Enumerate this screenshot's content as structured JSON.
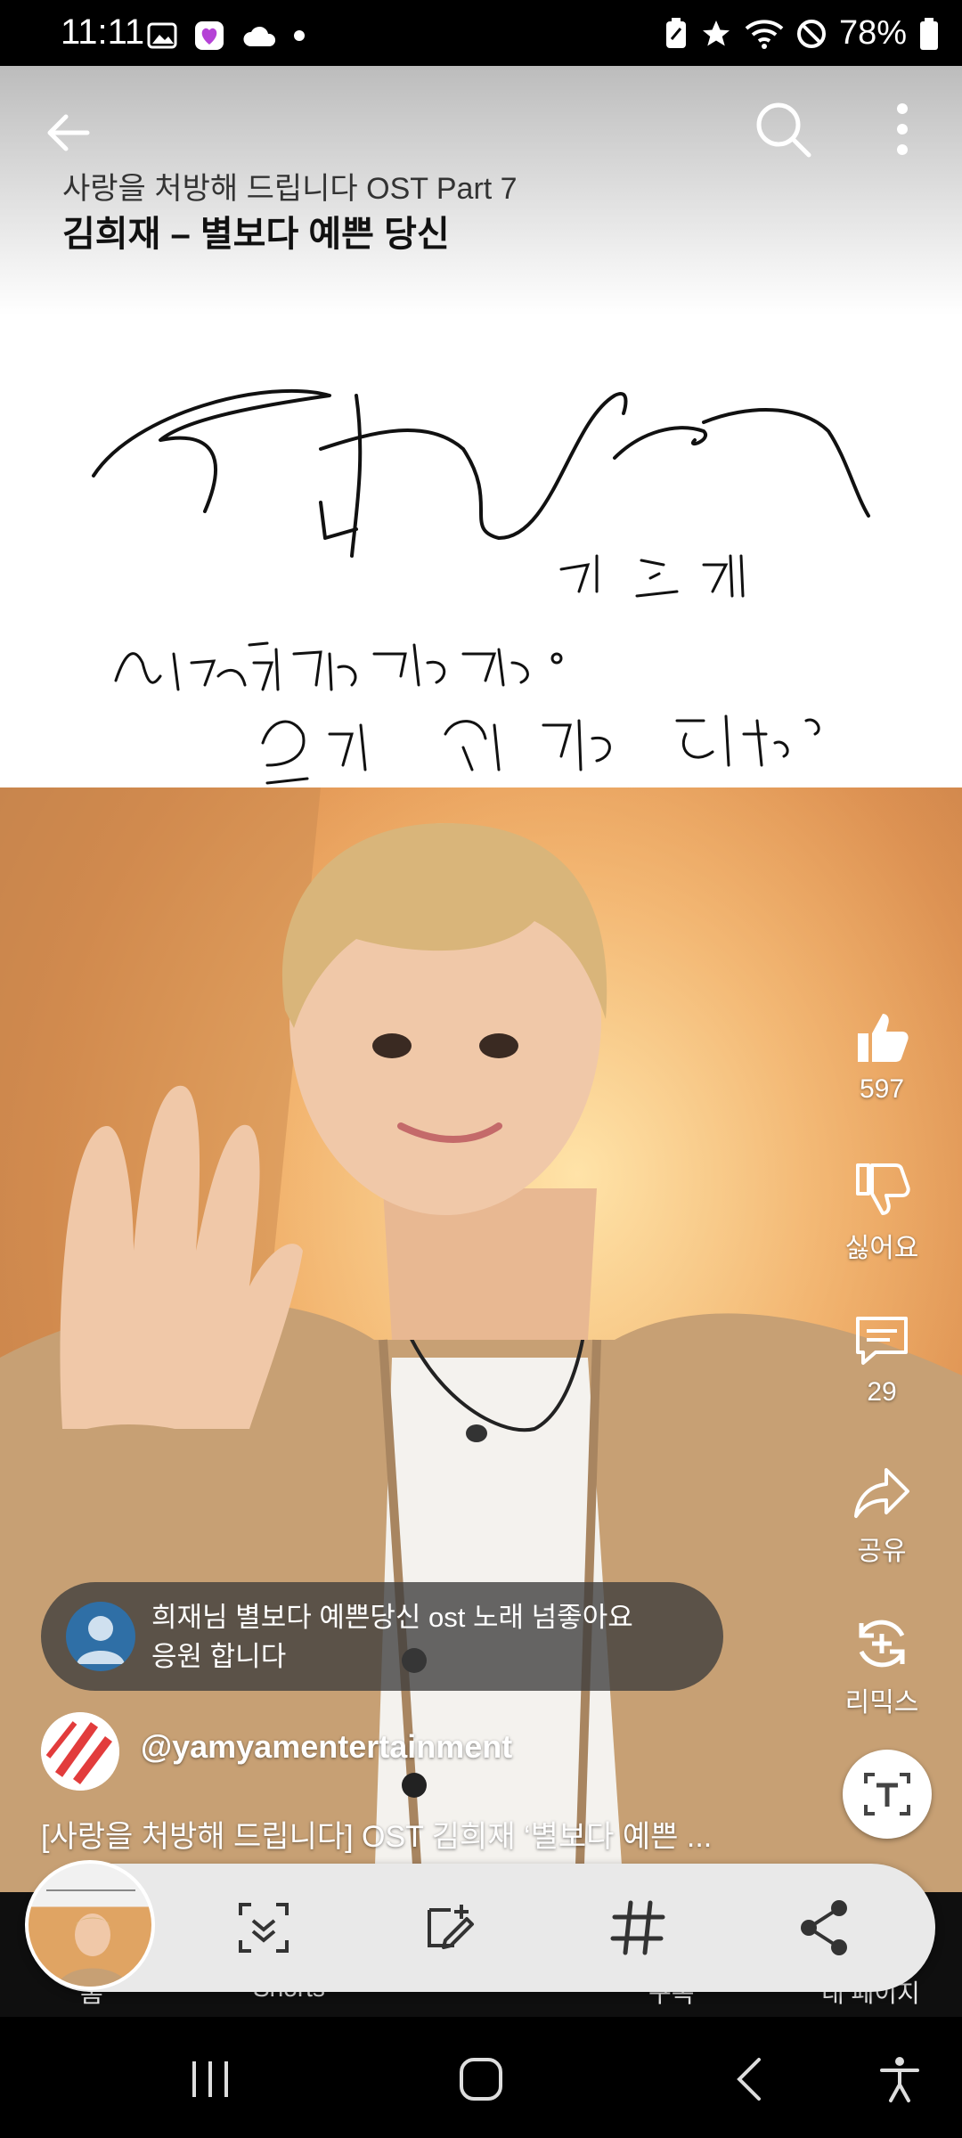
{
  "status_bar": {
    "time": "11:11",
    "battery": "78%"
  },
  "banner": {
    "ost_line": "사랑을 처방해 드립니다 OST Part 7",
    "song_line": "김희재 – 별보다 예쁜 당신"
  },
  "rail": {
    "like_count": "597",
    "dislike_label": "싫어요",
    "comment_count": "29",
    "share_label": "공유",
    "remix_label": "리믹스"
  },
  "comment": {
    "text_line1": "희재님 별보다 예쁜당신 ost 노래 넘좋아요",
    "text_line2": "응원 합니다"
  },
  "channel": {
    "handle": "@yamyamentertainment"
  },
  "video": {
    "title": "[사랑을 처방해 드립니다] OST 김희재 ‘별보다 예쁜  ...",
    "progress_fraction": 0.03
  },
  "bottom_nav": {
    "items": [
      "홈",
      "Shorts",
      "",
      "구독",
      "내 페이지"
    ]
  },
  "colors": {
    "accent": "#ff1f1f",
    "toolbar_bg": "#e9e9e9"
  },
  "icons": [
    "back-icon",
    "search-icon",
    "more-icon",
    "like-icon",
    "dislike-icon",
    "comment-icon",
    "share-icon",
    "remix-icon",
    "translate-icon",
    "smart-select-icon",
    "draw-icon",
    "hashtag-icon",
    "share-toolbar-icon"
  ]
}
